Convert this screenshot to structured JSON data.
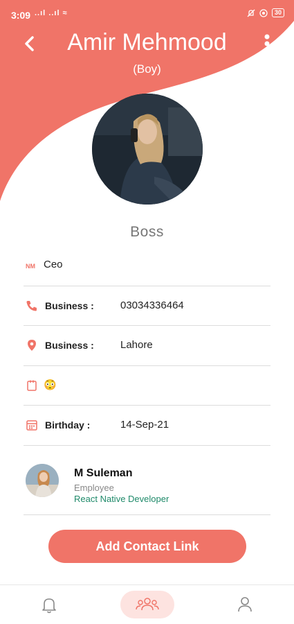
{
  "status_bar": {
    "time": "3:09",
    "signal": "..ıl ..ıl ≈",
    "battery": "30"
  },
  "header": {
    "title": "Amir Mehmood",
    "subtitle": "(Boy)",
    "accent_color": "#f07468"
  },
  "profile": {
    "role_title": "Boss"
  },
  "rows": [
    {
      "icon": "badge-icon",
      "label": "",
      "value": "Ceo"
    },
    {
      "icon": "phone-icon",
      "label": "Business :",
      "value": "03034336464"
    },
    {
      "icon": "location-pin-icon",
      "label": "Business :",
      "value": "Lahore"
    },
    {
      "icon": "note-icon",
      "label": "",
      "value": "😳"
    },
    {
      "icon": "calendar-icon",
      "label": "Birthday :",
      "value": "14-Sep-21"
    }
  ],
  "contact": {
    "name": "M Suleman",
    "role": "Employee",
    "job": "React Native Developer"
  },
  "actions": {
    "add_contact_label": "Add Contact Link"
  },
  "bottom_nav": [
    {
      "icon": "bell-icon",
      "active": false
    },
    {
      "icon": "group-icon",
      "active": true
    },
    {
      "icon": "user-icon",
      "active": false
    }
  ]
}
